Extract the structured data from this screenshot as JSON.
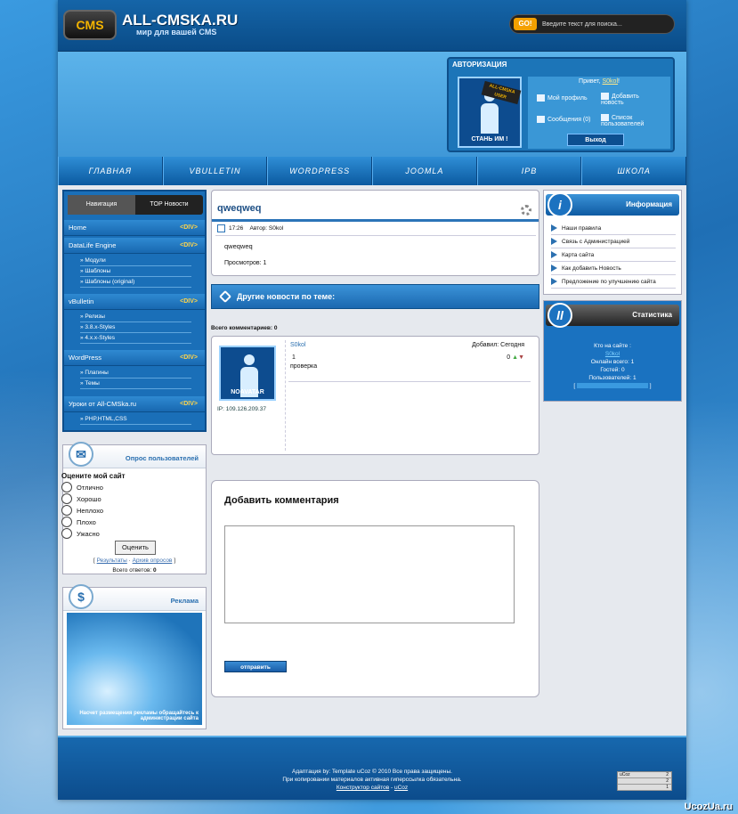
{
  "header": {
    "logo": "CMS",
    "title": "ALL-CMSKA.RU",
    "subtitle": "мир для вашей CMS",
    "search_button": "GO!",
    "search_placeholder": "Введите текст для поиска..."
  },
  "auth": {
    "title": "АВТОРИЗАЦИЯ",
    "avatar_badge": "ALL-CMSKA USER",
    "avatar_caption": "СТАНЬ ИМ !",
    "hello_prefix": "Привет,",
    "username": "S0kol",
    "hello_suffix": "!",
    "profile": "Мой профиль",
    "add_news": "Добавить новость",
    "messages": "Сообщения (0)",
    "users_list": "Список пользователей",
    "logout": "Выход"
  },
  "nav": [
    "ГЛАВНАЯ",
    "VBULLETIN",
    "WORDPRESS",
    "JOOMLA",
    "IPB",
    "ШКОЛА"
  ],
  "sidebar": {
    "tab_nav": "Навигация",
    "tab_top": "TOP Новости",
    "div_label": "<DIV>",
    "sections": [
      {
        "label": "Home",
        "subs": []
      },
      {
        "label": "DataLife Engine",
        "subs": [
          "» Модули",
          "» Шаблоны",
          "» Шаблоны (original)"
        ]
      },
      {
        "label": "vBulletin",
        "subs": [
          "» Релизы",
          "» 3.8.x-Styles",
          "» 4.x.x-Styles"
        ]
      },
      {
        "label": "WordPress",
        "subs": [
          "» Плагины",
          "» Темы"
        ]
      },
      {
        "label": "Уроки от All-CMSka.ru",
        "subs": [
          "» PHP,HTML,CSS"
        ]
      }
    ]
  },
  "poll": {
    "title": "Опрос пользователей",
    "question": "Оцените мой сайт",
    "options": [
      "Отлично",
      "Хорошо",
      "Неплохо",
      "Плохо",
      "Ужасно"
    ],
    "vote": "Оценить",
    "results": "Результаты",
    "archive": "Архив опросов",
    "total_label": "Всего ответов:",
    "total": "0"
  },
  "ad": {
    "title": "Реклама",
    "text": "Насчет размещения рекламы обращайтесь к администрации сайта"
  },
  "news": {
    "title": "qweqweq",
    "time": "17:26",
    "author": "Автор: S0kol",
    "body": "qweqweq",
    "views": "Просмотров: 1"
  },
  "related": {
    "title": "Другие новости по теме:"
  },
  "comments": {
    "total": "Всего комментариев: 0",
    "user": "S0kol",
    "added": "Добавил: Сегодня",
    "num": "1",
    "text": "проверка",
    "score": "0",
    "ip": "IP: 109.126.209.37",
    "avatar": "NOAVATAR"
  },
  "add_comment": {
    "title": "Добавить комментария",
    "send": "отправить"
  },
  "info": {
    "title": "Информация",
    "links": [
      "Наши правила",
      "Связь с Администрацией",
      "Карта сайта",
      "Как добавить Новость",
      "Предложение по улучшению сайта"
    ]
  },
  "stats": {
    "title": "Статистика",
    "who": "Кто на сайте :",
    "online": "Онлайн всего: 1",
    "guests": "Гостей: 0",
    "users": "Пользователей: 1",
    "user_link": "S0kol"
  },
  "footer": {
    "line1": "Адаптация by: Template uCoz © 2010 Все права защищены.",
    "line2": "При копировании материалов активная гиперссылка обязательна.",
    "link1": "Конструктор сайтов",
    "link2": "uCoz",
    "counter": [
      [
        "uCoz",
        "2"
      ],
      [
        "",
        "2"
      ],
      [
        "",
        "1"
      ]
    ]
  },
  "watermark": "UcozUa.ru"
}
